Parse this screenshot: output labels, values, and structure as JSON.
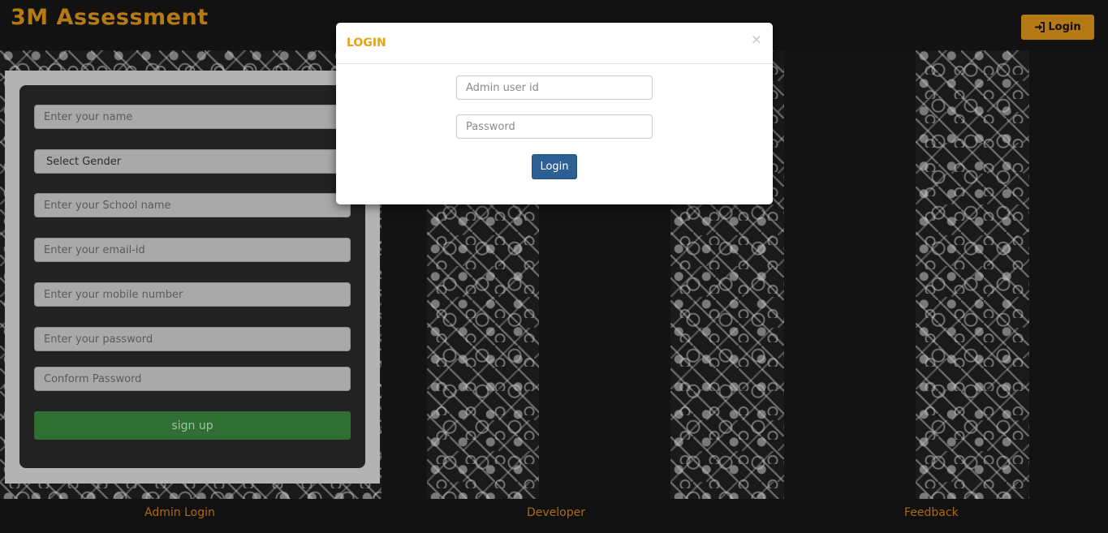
{
  "header": {
    "brand": "3M Assessment",
    "login_button": "Login",
    "login_icon": "sign-in-icon"
  },
  "signup_form": {
    "name_placeholder": "Enter your name",
    "gender_select": "Select Gender",
    "school_placeholder": "Enter your School name",
    "email_placeholder": "Enter your email-id",
    "mobile_placeholder": "Enter your mobile number",
    "password_placeholder": "Enter your password",
    "confirm_placeholder": "Conform Password",
    "submit_label": "sign up"
  },
  "modal": {
    "title": "LOGIN",
    "close_label": "×",
    "user_placeholder": "Admin user id",
    "password_placeholder": "Password",
    "submit_label": "Login"
  },
  "footer": {
    "links": [
      "Admin Login",
      "Developer",
      "Feedback"
    ]
  },
  "colors": {
    "brand": "#b57a16",
    "modal_title": "#e6a21a",
    "signup_button": "#2f6f33",
    "modal_button": "#2c5f94",
    "footer_link": "#b0690f"
  }
}
